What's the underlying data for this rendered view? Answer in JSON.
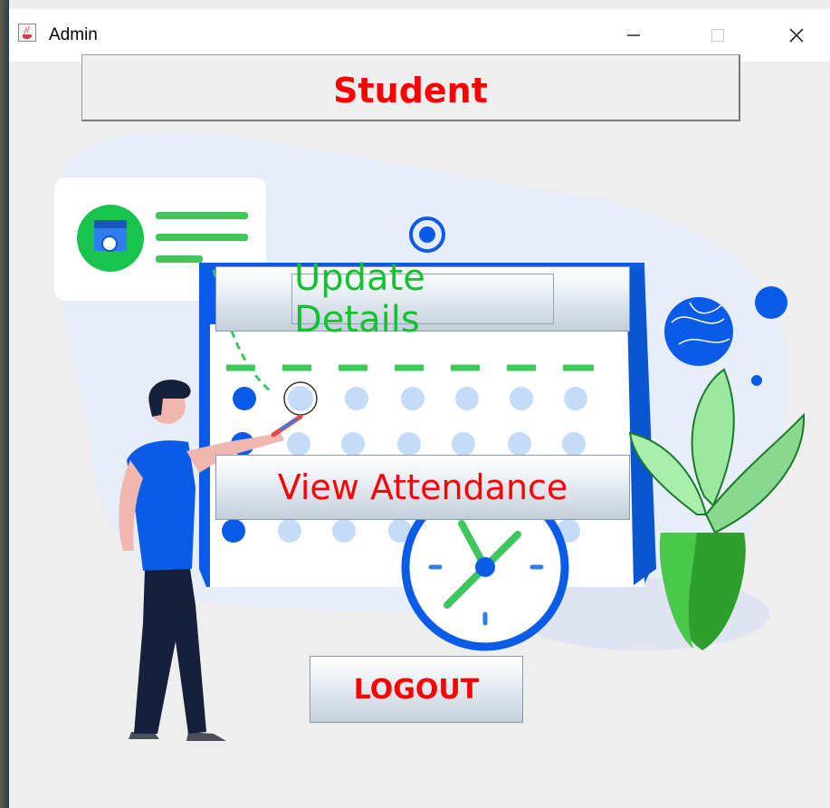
{
  "window": {
    "title": "Admin",
    "icon": "java-coffee-icon",
    "controls": {
      "minimize": "minimize-icon",
      "maximize": "maximize-icon",
      "close": "close-icon"
    }
  },
  "header": {
    "label": "Student"
  },
  "buttons": {
    "update_details": "Update Details",
    "view_attendance": "View Attendance",
    "logout": "LOGOUT"
  },
  "colors": {
    "accent_red": "#ff0000",
    "accent_green": "#14c130",
    "illustration_blue": "#0a5ce8",
    "illustration_green": "#3cc85a"
  }
}
